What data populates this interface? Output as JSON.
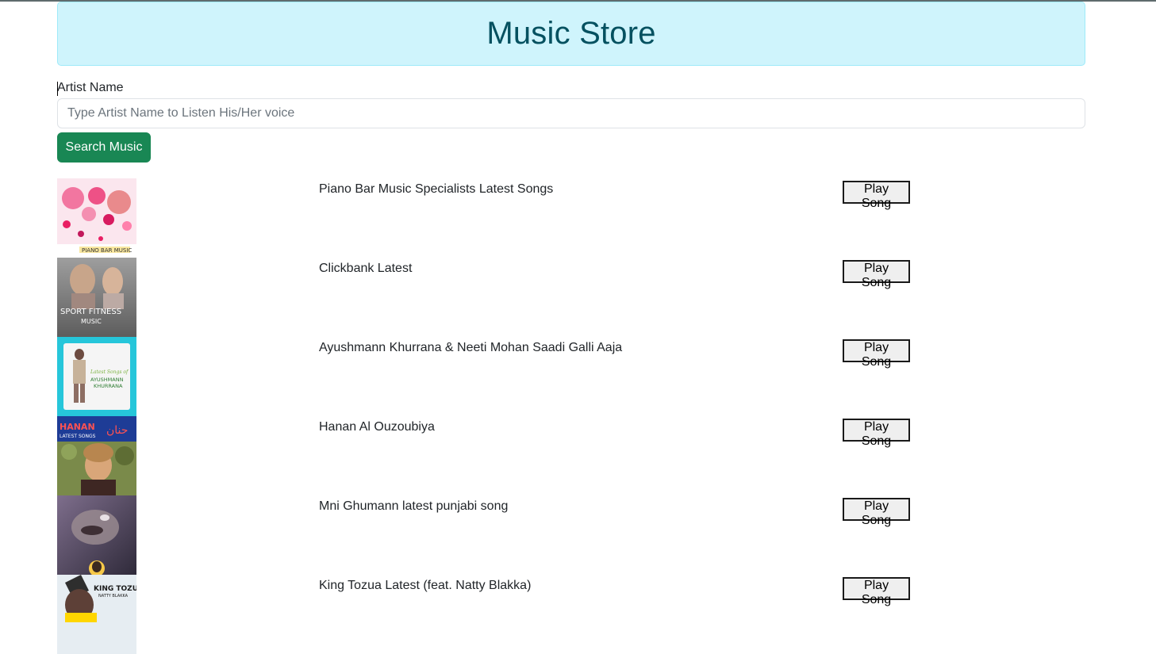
{
  "header": {
    "title": "Music Store"
  },
  "search": {
    "label": "Artist Name",
    "placeholder": "Type Artist Name to Listen His/Her voice",
    "value": "",
    "button_label": "Search Music"
  },
  "songs": [
    {
      "title": "Piano Bar Music Specialists Latest Songs",
      "button_label": "Play Song",
      "cover_text": "PIANO BAR MUSIC"
    },
    {
      "title": "Clickbank Latest",
      "button_label": "Play Song",
      "cover_text": "SPORT FITNESS MUSIC"
    },
    {
      "title": "Ayushmann Khurrana & Neeti Mohan Saadi Galli Aaja",
      "button_label": "Play Song",
      "cover_text": "AYUSHMANN KHURRANA"
    },
    {
      "title": "Hanan Al Ouzoubiya",
      "button_label": "Play Song",
      "cover_text": "HANAN"
    },
    {
      "title": "Mni Ghumann latest punjabi song",
      "button_label": "Play Song",
      "cover_text": ""
    },
    {
      "title": "King Tozua Latest (feat. Natty Blakka)",
      "button_label": "Play Song",
      "cover_text": "KING TOZUA"
    }
  ],
  "colors": {
    "header_bg": "#cff4fc",
    "header_text": "#055160",
    "search_button": "#198754"
  }
}
